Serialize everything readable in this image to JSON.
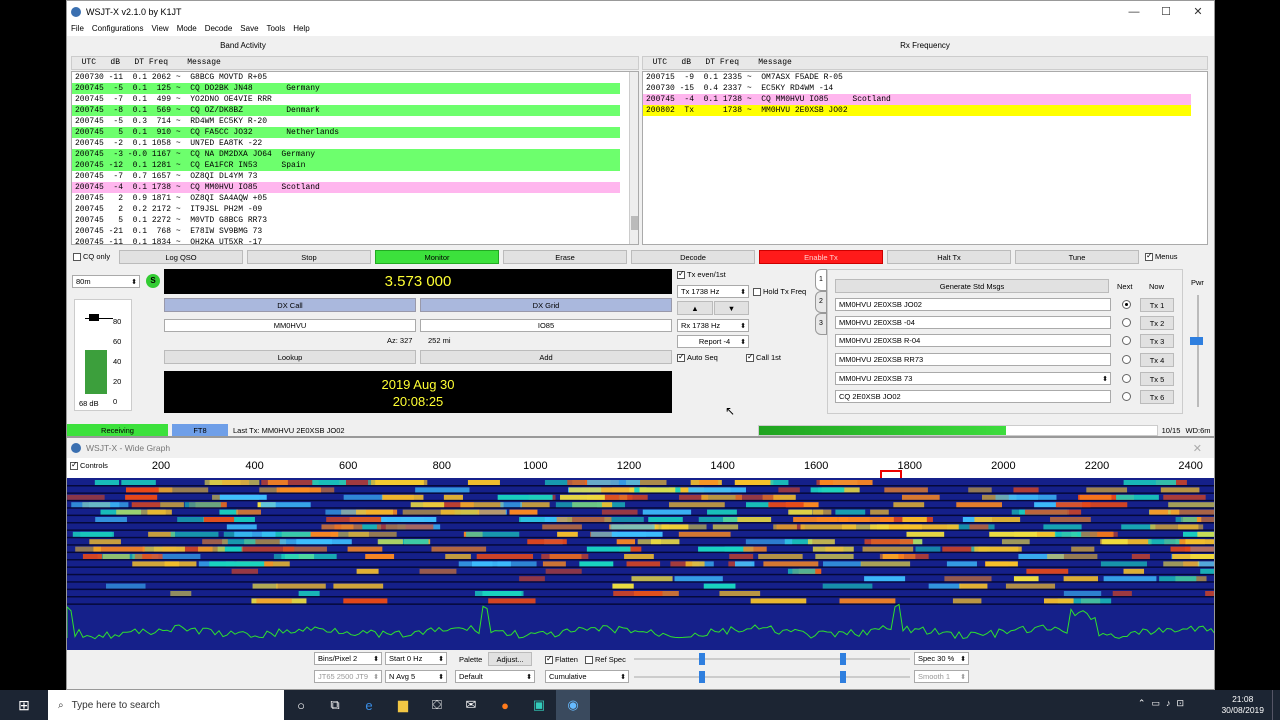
{
  "window": {
    "title": "WSJT-X   v2.1.0   by K1JT",
    "minimize": "—",
    "maximize": "☐",
    "close": "✕"
  },
  "menu": [
    "File",
    "Configurations",
    "View",
    "Mode",
    "Decode",
    "Save",
    "Tools",
    "Help"
  ],
  "band_activity": {
    "title": "Band Activity",
    "header": "  UTC   dB   DT Freq    Message",
    "rows": [
      {
        "text": "200730 -11  0.1 2062 ~  G8BCG MOVTD R+05",
        "hl": ""
      },
      {
        "text": "200745  -5  0.1  125 ~  CQ DO2BK JN48       Germany",
        "hl": "g"
      },
      {
        "text": "200745  -7  0.1  499 ~  YO2DNO OE4VIE RRR",
        "hl": ""
      },
      {
        "text": "200745  -8  0.1  569 ~  CQ OZ/DK8BZ         Denmark",
        "hl": "g"
      },
      {
        "text": "200745  -5  0.3  714 ~  RD4WM EC5KY R-20",
        "hl": ""
      },
      {
        "text": "200745   5  0.1  910 ~  CQ FA5CC JO32       Netherlands",
        "hl": "g"
      },
      {
        "text": "200745  -2  0.1 1058 ~  UN7ED EA8TK -22",
        "hl": ""
      },
      {
        "text": "200745  -3 -0.0 1167 ~  CQ NA DM2DXA JO64  Germany",
        "hl": "g"
      },
      {
        "text": "200745 -12  0.1 1281 ~  CQ EA1FCR IN53     Spain",
        "hl": "g"
      },
      {
        "text": "200745  -7  0.7 1657 ~  OZ8QI DL4YM 73",
        "hl": ""
      },
      {
        "text": "200745  -4  0.1 1738 ~  CQ MM0HVU IO85     Scotland",
        "hl": "p"
      },
      {
        "text": "200745   2  0.9 1871 ~  OZ8QI SA4AQW +05",
        "hl": ""
      },
      {
        "text": "200745   2  0.2 2172 ~  IT9JSL PH2M -09",
        "hl": ""
      },
      {
        "text": "200745   5  0.1 2272 ~  M0VTD G8BCG RR73",
        "hl": ""
      },
      {
        "text": "200745 -21  0.1  768 ~  E78IW SV9BMG 73",
        "hl": ""
      },
      {
        "text": "200745 -11  0.1 1834 ~  OH2KA UT5XR -17",
        "hl": ""
      }
    ]
  },
  "rx_frequency": {
    "title": "Rx Frequency",
    "header": "  UTC   dB   DT Freq    Message",
    "rows": [
      {
        "text": "200715  -9  0.1 2335 ~  OM7ASX F5ADE R-05",
        "hl": ""
      },
      {
        "text": "200730 -15  0.4 2337 ~  EC5KY RD4WM -14",
        "hl": ""
      },
      {
        "text": "200745  -4  0.1 1738 ~  CQ MM0HVU IO85     Scotland",
        "hl": "p"
      },
      {
        "text": "200802  Tx      1738 ~  MM0HVU 2E0XSB JO02",
        "hl": "y"
      }
    ]
  },
  "buttons": {
    "cq_only": "CQ only",
    "log_qso": "Log QSO",
    "stop": "Stop",
    "monitor": "Monitor",
    "erase": "Erase",
    "decode": "Decode",
    "enable_tx": "Enable Tx",
    "halt_tx": "Halt Tx",
    "tune": "Tune",
    "menus": "Menus",
    "lookup": "Lookup",
    "add": "Add",
    "generate": "Generate Std Msgs",
    "up": "▲",
    "down": "▼"
  },
  "band": "80m",
  "s_badge": "S",
  "frequency": "3.573 000",
  "meter": {
    "ticks": [
      "80",
      "60",
      "40",
      "20",
      "0"
    ],
    "level_db": "68 dB",
    "fill": 0.55
  },
  "dx": {
    "call_label": "DX Call",
    "grid_label": "DX Grid",
    "call": "MM0HVU",
    "grid": "IO85",
    "az": "Az: 327",
    "dist": "252 mi"
  },
  "datetime": {
    "date": "2019 Aug 30",
    "time": "20:08:25"
  },
  "tx": {
    "even": "Tx even/1st",
    "tx_freq": "Tx  1738 Hz",
    "hold": "Hold Tx Freq",
    "rx_freq": "Rx  1738 Hz",
    "report": "Report -4",
    "auto_seq": "Auto Seq",
    "call_1st": "Call 1st"
  },
  "tabs": [
    "1",
    "2",
    "3"
  ],
  "msgs": {
    "next_label": "Next",
    "now_label": "Now",
    "pwr_label": "Pwr",
    "items": [
      {
        "text": "MM0HVU 2E0XSB JO02",
        "btn": "Tx 1"
      },
      {
        "text": "MM0HVU 2E0XSB -04",
        "btn": "Tx 2"
      },
      {
        "text": "MM0HVU 2E0XSB R-04",
        "btn": "Tx 3"
      },
      {
        "text": "MM0HVU 2E0XSB RR73",
        "btn": "Tx 4"
      },
      {
        "text": "MM0HVU 2E0XSB 73",
        "btn": "Tx 5"
      },
      {
        "text": "CQ 2E0XSB JO02",
        "btn": "Tx 6"
      }
    ]
  },
  "statusbar": {
    "state": "Receiving",
    "mode": "FT8",
    "last_tx": "Last Tx: MM0HVU 2E0XSB JO02",
    "progress": 0.62,
    "count": "10/15",
    "wd": "WD:6m"
  },
  "widegraph": {
    "title": "WSJT-X - Wide Graph",
    "controls_label": "Controls",
    "scale": [
      "200",
      "400",
      "600",
      "800",
      "1000",
      "1200",
      "1400",
      "1600",
      "1800",
      "2000",
      "2200",
      "2400"
    ],
    "bins_pixel": "Bins/Pixel  2",
    "start": "Start 0 Hz",
    "palette": "Palette",
    "adjust": "Adjust...",
    "flatten": "Flatten",
    "ref_spec": "Ref Spec",
    "spec": "Spec 30 %",
    "jt65": "JT65  2500  JT9",
    "navg": "N Avg 5",
    "palette_sel": "Default",
    "mode_sel": "Cumulative",
    "smooth": "Smooth  1"
  },
  "taskbar": {
    "search": "Type here to search",
    "time": "21:08",
    "date": "30/08/2019"
  }
}
